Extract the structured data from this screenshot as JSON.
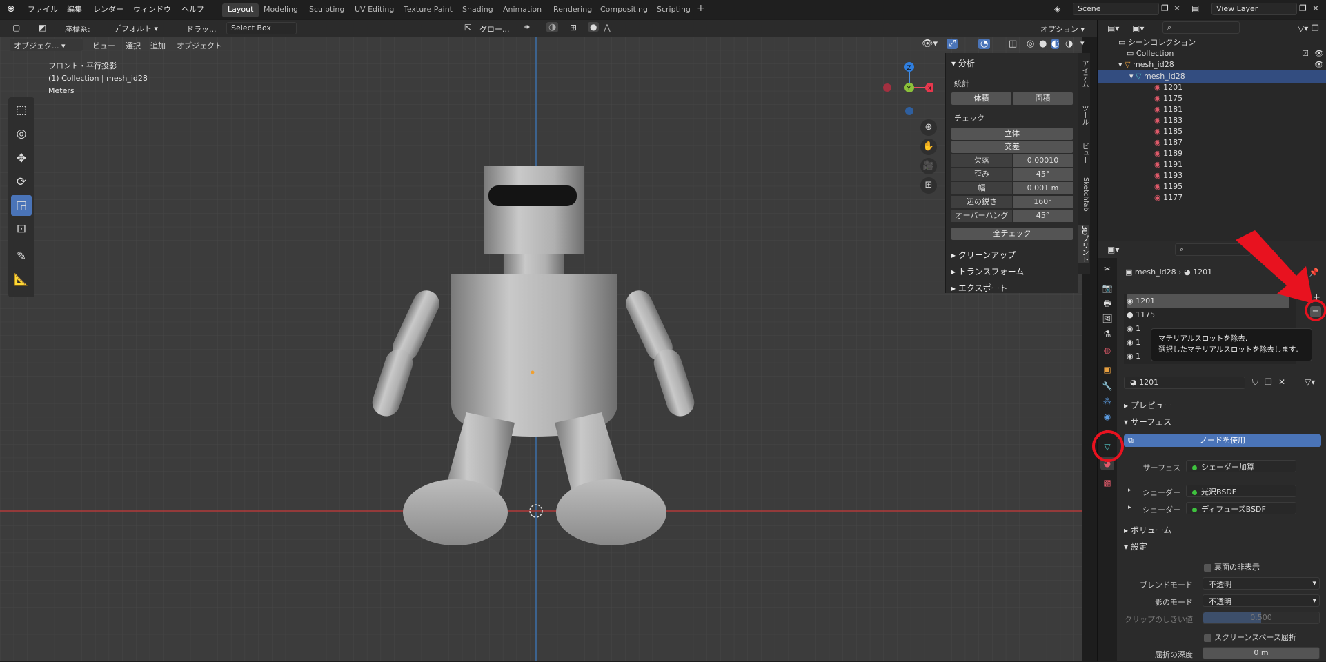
{
  "menu": {
    "items": [
      "ファイル",
      "編集",
      "レンダー",
      "ウィンドウ",
      "ヘルプ"
    ]
  },
  "workspaces": [
    "Layout",
    "Modeling",
    "Sculpting",
    "UV Editing",
    "Texture Paint",
    "Shading",
    "Animation",
    "Rendering",
    "Compositing",
    "Scripting"
  ],
  "scene": {
    "name": "Scene",
    "view_layer": "View Layer"
  },
  "tool_settings": {
    "coord_label": "座標系:",
    "coord_value": "デフォルト",
    "drag_label": "ドラッ...",
    "select_mode": "Select Box",
    "transform": "グロー...",
    "options": "オプション"
  },
  "viewport_header": {
    "mode": "オブジェク...",
    "view": "ビュー",
    "select": "選択",
    "add": "追加",
    "object": "オブジェクト"
  },
  "viewport_info": {
    "line1": "フロント・平行投影",
    "line2": "(1) Collection | mesh_id28",
    "line3": "Meters"
  },
  "gizmo": {
    "z": "Z",
    "y": "Y",
    "x": "X"
  },
  "n_panel": {
    "analysis": "分析",
    "stats": "統計",
    "volume": "体積",
    "area": "面積",
    "check": "チェック",
    "solid": "立体",
    "intersect": "交差",
    "rows": [
      {
        "k": "欠落",
        "v": "0.00010"
      },
      {
        "k": "歪み",
        "v": "45°"
      },
      {
        "k": "幅",
        "v": "0.001 m"
      },
      {
        "k": "辺の鋭さ",
        "v": "160°"
      },
      {
        "k": "オーバーハング",
        "v": "45°"
      }
    ],
    "check_all": "全チェック",
    "cleanup": "クリーンアップ",
    "transform": "トランスフォーム",
    "export": "エクスポート"
  },
  "side_tabs": [
    "アイテム",
    "ツール",
    "ビュー",
    "Sketchfab",
    "3Dプリント"
  ],
  "outliner": {
    "scene_collection": "シーンコレクション",
    "collection": "Collection",
    "object": "mesh_id28",
    "mesh": "mesh_id28",
    "materials": [
      "1201",
      "1175",
      "1181",
      "1183",
      "1185",
      "1187",
      "1189",
      "1191",
      "1193",
      "1195",
      "1177"
    ]
  },
  "properties": {
    "breadcrumb_object": "mesh_id28",
    "breadcrumb_material": "1201",
    "slots": [
      "1201",
      "1175",
      "1",
      "1",
      "1"
    ],
    "material_name": "1201",
    "preview": "プレビュー",
    "surface": "サーフェス",
    "use_nodes": "ノードを使用",
    "surface_label": "サーフェス",
    "surface_value": "シェーダー加算",
    "shader_label": "シェーダー",
    "shader1": "光沢BSDF",
    "shader2": "ディフューズBSDF",
    "volume": "ボリューム",
    "settings": "設定",
    "backface": "裏面の非表示",
    "blend_label": "ブレンドモード",
    "blend_value": "不透明",
    "shadow_label": "影のモード",
    "shadow_value": "不透明",
    "clip_label": "クリップのしきい値",
    "clip_value": "0.500",
    "ss_refraction": "スクリーンスペース屈折",
    "refraction_depth_label": "屈折の深度",
    "refraction_depth_value": "0 m"
  },
  "tooltip": {
    "line1": "マテリアルスロットを除去.",
    "line2": "選択したマテリアルスロットを除去します."
  },
  "colors": {
    "accent": "#4a74b8",
    "annotation": "#e8121f",
    "selected_row": "#334d80"
  }
}
